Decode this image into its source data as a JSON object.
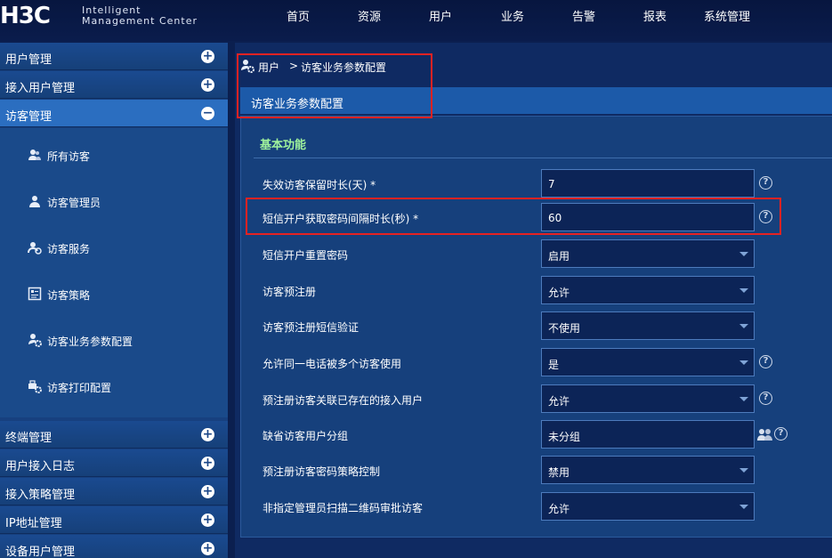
{
  "header": {
    "logo": "H3C",
    "logo_line1": "Intelligent",
    "logo_line2": "Management Center",
    "nav": [
      "首页",
      "资源",
      "用户",
      "业务",
      "告警",
      "报表",
      "系统管理"
    ]
  },
  "sidebar": {
    "heads_top": [
      {
        "label": "用户管理",
        "icon": "plus-circle-icon"
      },
      {
        "label": "接入用户管理",
        "icon": "plus-circle-icon"
      },
      {
        "label": "访客管理",
        "icon": "minus-circle-icon",
        "active": true
      }
    ],
    "sub_items": [
      {
        "label": "所有访客",
        "icon": "users-icon"
      },
      {
        "label": "访客管理员",
        "icon": "user-icon"
      },
      {
        "label": "访客服务",
        "icon": "user-service-icon"
      },
      {
        "label": "访客策略",
        "icon": "policy-icon"
      },
      {
        "label": "访客业务参数配置",
        "icon": "user-settings-icon"
      },
      {
        "label": "访客打印配置",
        "icon": "print-settings-icon"
      }
    ],
    "heads_bottom": [
      {
        "label": "终端管理",
        "icon": "plus-circle-icon"
      },
      {
        "label": "用户接入日志",
        "icon": "plus-circle-icon"
      },
      {
        "label": "接入策略管理",
        "icon": "plus-circle-icon"
      },
      {
        "label": "IP地址管理",
        "icon": "plus-circle-icon"
      },
      {
        "label": "设备用户管理",
        "icon": "plus-circle-icon"
      }
    ]
  },
  "breadcrumb": {
    "user": "用户",
    "sep": ">",
    "page": "访客业务参数配置"
  },
  "page_title": "访客业务参数配置",
  "section_title": "基本功能",
  "form": [
    {
      "label": "失效访客保留时长(天) *",
      "value": "7",
      "type": "input",
      "help": true
    },
    {
      "label": "短信开户获取密码间隔时长(秒) *",
      "value": "60",
      "type": "input",
      "help": true
    },
    {
      "label": "短信开户重置密码",
      "value": "启用",
      "type": "select",
      "help": false
    },
    {
      "label": "访客预注册",
      "value": "允许",
      "type": "select",
      "help": false
    },
    {
      "label": "访客预注册短信验证",
      "value": "不使用",
      "type": "select",
      "help": false
    },
    {
      "label": "允许同一电话被多个访客使用",
      "value": "是",
      "type": "select",
      "help": true
    },
    {
      "label": "预注册访客关联已存在的接入用户",
      "value": "允许",
      "type": "select",
      "help": true
    },
    {
      "label": "缺省访客用户分组",
      "value": "未分组",
      "type": "input-group",
      "help": true
    },
    {
      "label": "预注册访客密码策略控制",
      "value": "禁用",
      "type": "select",
      "help": false
    },
    {
      "label": "非指定管理员扫描二维码审批访客",
      "value": "允许",
      "type": "select",
      "help": false
    }
  ],
  "help_glyph": "?",
  "colors": {
    "background": "#0b1f4f",
    "sidebar": "#17407f",
    "active_item": "#2b6ec0",
    "section_title": "#9ff29c",
    "highlight": "#e62222"
  }
}
